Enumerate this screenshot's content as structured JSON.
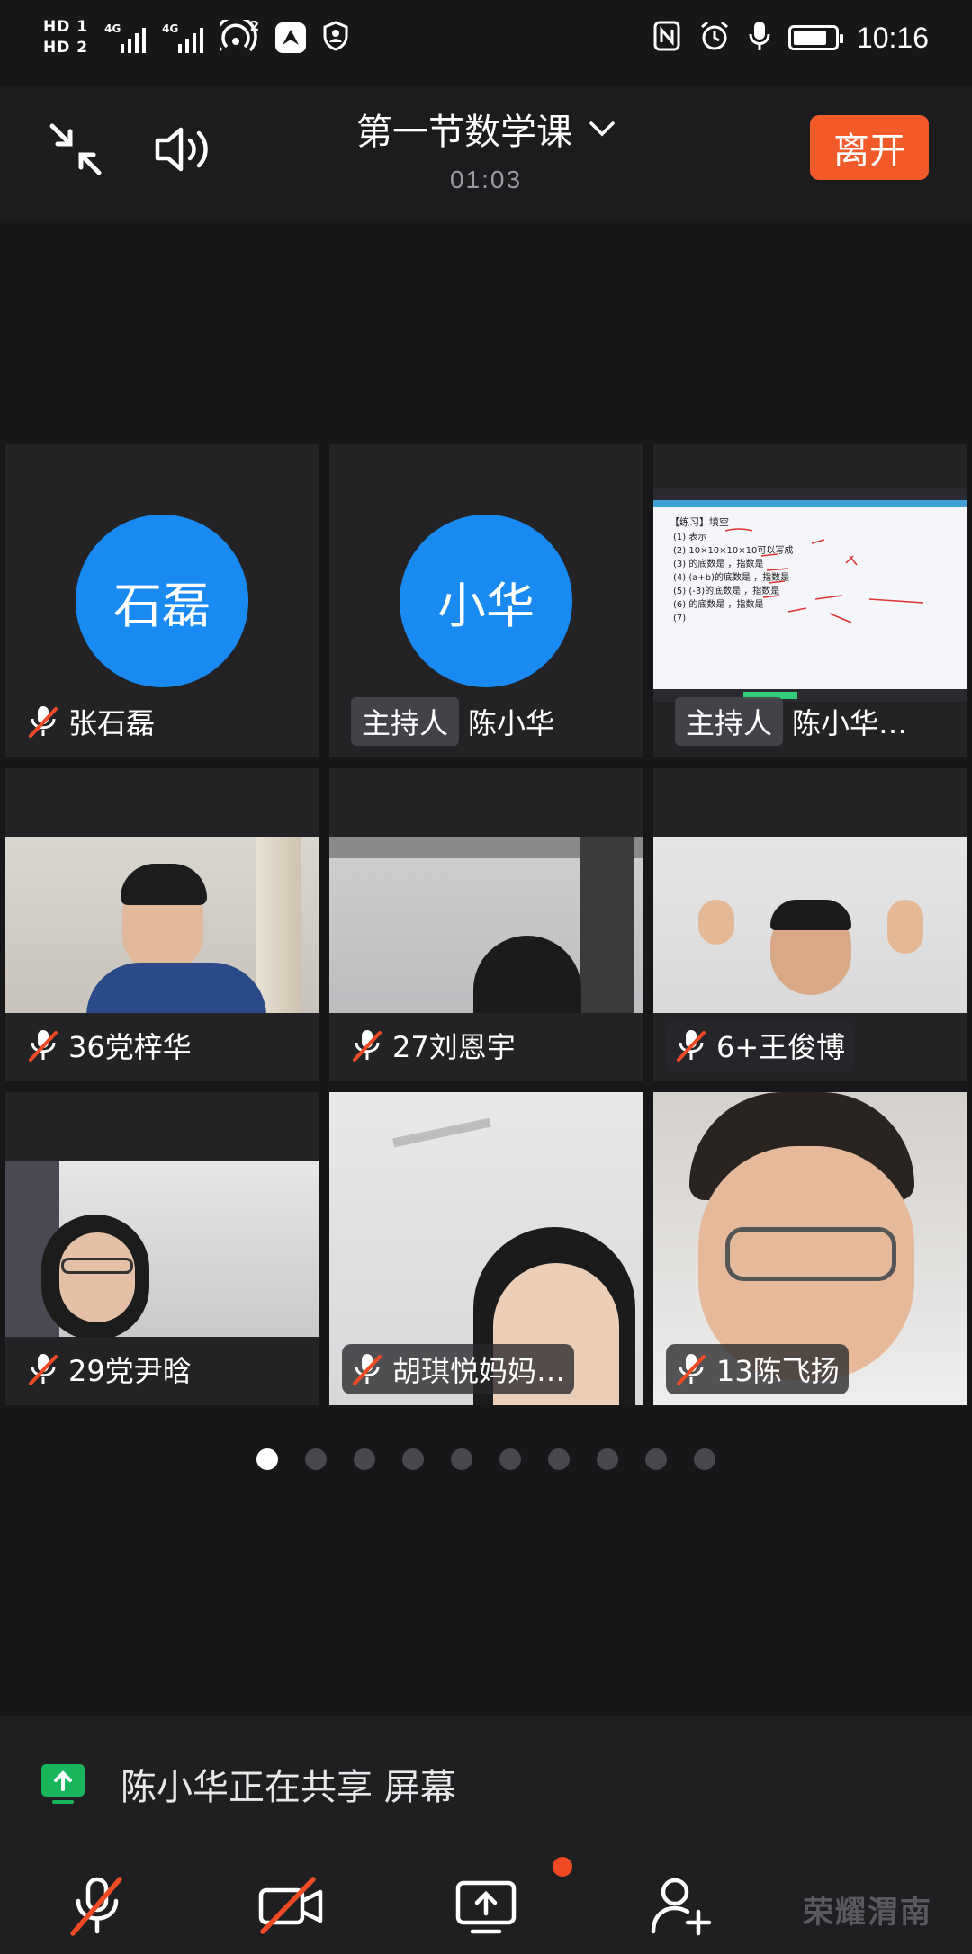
{
  "status_bar": {
    "sim1": "HD 1",
    "sim2": "HD 2",
    "net1": "4G",
    "net2": "4G",
    "hotspot_count": "2",
    "time": "10:16"
  },
  "header": {
    "title": "第一节数学课",
    "timer": "01:03",
    "leave_label": "离开"
  },
  "participants": [
    {
      "avatar_text": "石磊",
      "name": "张石磊",
      "host_badge": "",
      "muted": true,
      "kind": "avatar"
    },
    {
      "avatar_text": "小华",
      "name": "陈小华",
      "host_badge": "主持人",
      "muted": false,
      "kind": "avatar"
    },
    {
      "avatar_text": "",
      "name": "陈小华…",
      "host_badge": "主持人",
      "muted": false,
      "kind": "screen"
    },
    {
      "avatar_text": "",
      "name": "36党梓华",
      "host_badge": "",
      "muted": true,
      "kind": "video"
    },
    {
      "avatar_text": "",
      "name": "27刘恩宇",
      "host_badge": "",
      "muted": true,
      "kind": "video"
    },
    {
      "avatar_text": "",
      "name": "6+王俊博",
      "host_badge": "",
      "muted": true,
      "kind": "video"
    },
    {
      "avatar_text": "",
      "name": "29党尹晗",
      "host_badge": "",
      "muted": true,
      "kind": "video"
    },
    {
      "avatar_text": "",
      "name": "胡琪悦妈妈…",
      "host_badge": "",
      "muted": true,
      "kind": "video"
    },
    {
      "avatar_text": "",
      "name": "13陈飞扬",
      "host_badge": "",
      "muted": true,
      "kind": "video"
    }
  ],
  "screen_share_preview": {
    "heading": "【练习】填空",
    "lines": [
      "(1) 表示",
      "(2) 10×10×10×10可以写成",
      "(3) 的底数是     ，指数是",
      "(4) (a+b)的底数是     ，指数是",
      "(5) (-3)的底数是     ，指数是",
      "(6) 的底数是     ，指数是",
      "(7)"
    ]
  },
  "pager": {
    "count": 10,
    "active": 0
  },
  "sharing_banner": {
    "text": "陈小华正在共享 屏幕"
  },
  "toolbar": {
    "items": [
      "mute-mic",
      "stop-video",
      "share-screen",
      "manage-participants",
      "more"
    ]
  },
  "watermark": "荣耀渭南",
  "colors": {
    "accent": "#1a8af3",
    "leave": "#f25a2a",
    "muted_red": "#f04a24",
    "share_green": "#19b55a"
  }
}
